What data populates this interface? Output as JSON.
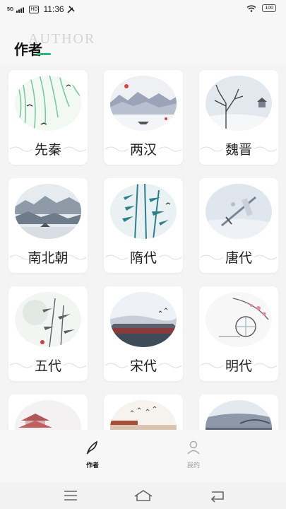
{
  "status_bar": {
    "network": "5G",
    "hd": "HD",
    "time": "11:36",
    "battery": "100"
  },
  "header": {
    "title": "作者",
    "subtitle": "AUTHOR",
    "accent_color": "#2bb673"
  },
  "dynasties": [
    {
      "label": "先秦",
      "art": "willow"
    },
    {
      "label": "两汉",
      "art": "mountains-boat"
    },
    {
      "label": "魏晋",
      "art": "snow-tree"
    },
    {
      "label": "南北朝",
      "art": "misty-mountains"
    },
    {
      "label": "隋代",
      "art": "bamboo"
    },
    {
      "label": "唐代",
      "art": "sword"
    },
    {
      "label": "五代",
      "art": "bamboo-moon"
    },
    {
      "label": "宋代",
      "art": "palace"
    },
    {
      "label": "明代",
      "art": "lantern"
    },
    {
      "label": "",
      "art": "pagoda"
    },
    {
      "label": "",
      "art": "birds-gate"
    },
    {
      "label": "",
      "art": "bridge"
    }
  ],
  "tab_bar": {
    "tabs": [
      {
        "label": "作者",
        "icon": "quill-icon",
        "active": true
      },
      {
        "label": "我的",
        "icon": "person-icon",
        "active": false
      }
    ]
  },
  "nav_bar": {
    "icons": [
      "menu-icon",
      "home-icon",
      "back-icon"
    ]
  }
}
